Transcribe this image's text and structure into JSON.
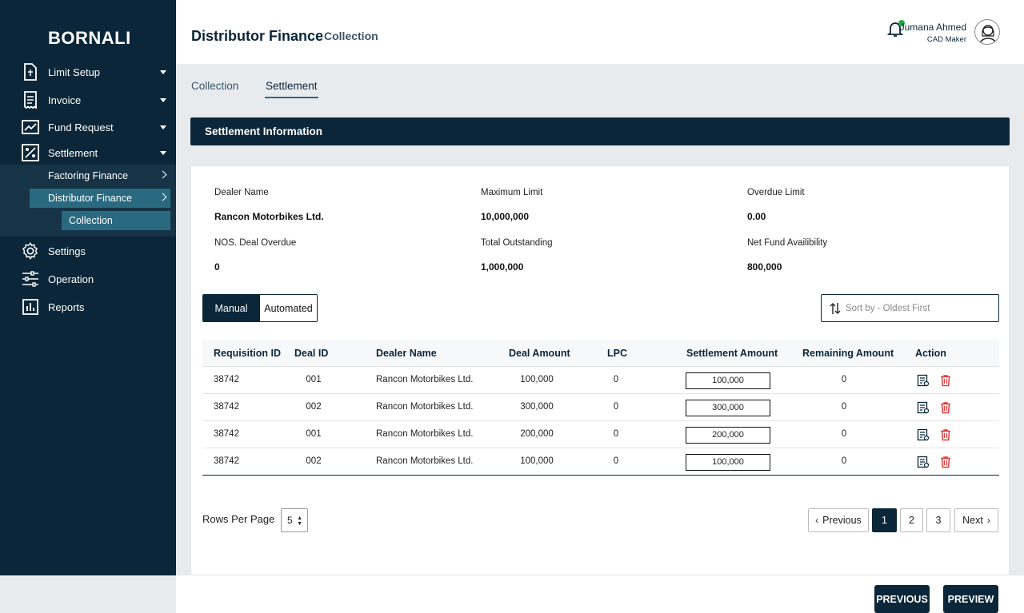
{
  "brand": "BORNALI",
  "sidebar": {
    "items": [
      {
        "label": "Limit Setup",
        "icon": "document-icon"
      },
      {
        "label": "Invoice",
        "icon": "receipt-icon"
      },
      {
        "label": "Fund Request",
        "icon": "chart-line-icon"
      },
      {
        "label": "Settlement",
        "icon": "percent-icon"
      },
      {
        "label": "Settings",
        "icon": "gear-icon"
      },
      {
        "label": "Operation",
        "icon": "sliders-icon"
      },
      {
        "label": "Reports",
        "icon": "bar-chart-icon"
      }
    ],
    "submenu": {
      "factoring": "Factoring Finance",
      "distributor": "Distributor Finance",
      "collection": "Collection"
    }
  },
  "header": {
    "title": "Distributor Finance",
    "subtitle": "Collection",
    "user_name": "Jumana Ahmed",
    "user_role": "CAD Maker"
  },
  "tabs": [
    "Collection",
    "Settlement"
  ],
  "section_title": "Settlement Information",
  "info": {
    "dealer_name_label": "Dealer Name",
    "dealer_name": "Rancon Motorbikes Ltd.",
    "max_limit_label": "Maximum Limit",
    "max_limit": "10,000,000",
    "overdue_limit_label": "Overdue Limit",
    "overdue_limit": "0.00",
    "deal_overdue_label": "NOS. Deal Overdue",
    "deal_overdue": "0",
    "total_outstanding_label": "Total Outstanding",
    "total_outstanding": "1,000,000",
    "net_fund_label": "Net Fund Availibility",
    "net_fund": "800,000"
  },
  "toggle": {
    "manual": "Manual",
    "automated": "Automated"
  },
  "sort": {
    "placeholder": "Sort by - Oldest First"
  },
  "table": {
    "headers": [
      "Requisition ID",
      "Deal ID",
      "Dealer Name",
      "Deal Amount",
      "LPC",
      "Settlement Amount",
      "Remaining Amount",
      "Action"
    ],
    "rows": [
      [
        "38742",
        "001",
        "Rancon Motorbikes Ltd.",
        "100,000",
        "0",
        "100,000",
        "0"
      ],
      [
        "38742",
        "002",
        "Rancon Motorbikes Ltd.",
        "300,000",
        "0",
        "300,000",
        "0"
      ],
      [
        "38742",
        "001",
        "Rancon Motorbikes Ltd.",
        "200,000",
        "0",
        "200,000",
        "0"
      ],
      [
        "38742",
        "002",
        "Rancon Motorbikes Ltd.",
        "100,000",
        "0",
        "100,000",
        "0"
      ]
    ]
  },
  "pagination": {
    "rows_per_page_label": "Rows Per Page",
    "rows_per_page": "5",
    "previous": "Previous",
    "next": "Next",
    "pages": [
      "1",
      "2",
      "3"
    ]
  },
  "footer": {
    "previous": "PREVIOUS",
    "preview": "PREVIEW"
  },
  "colors": {
    "primary": "#0b2638",
    "accent": "#2a6a80",
    "delete": "#e03c3c",
    "online": "#28a745"
  }
}
